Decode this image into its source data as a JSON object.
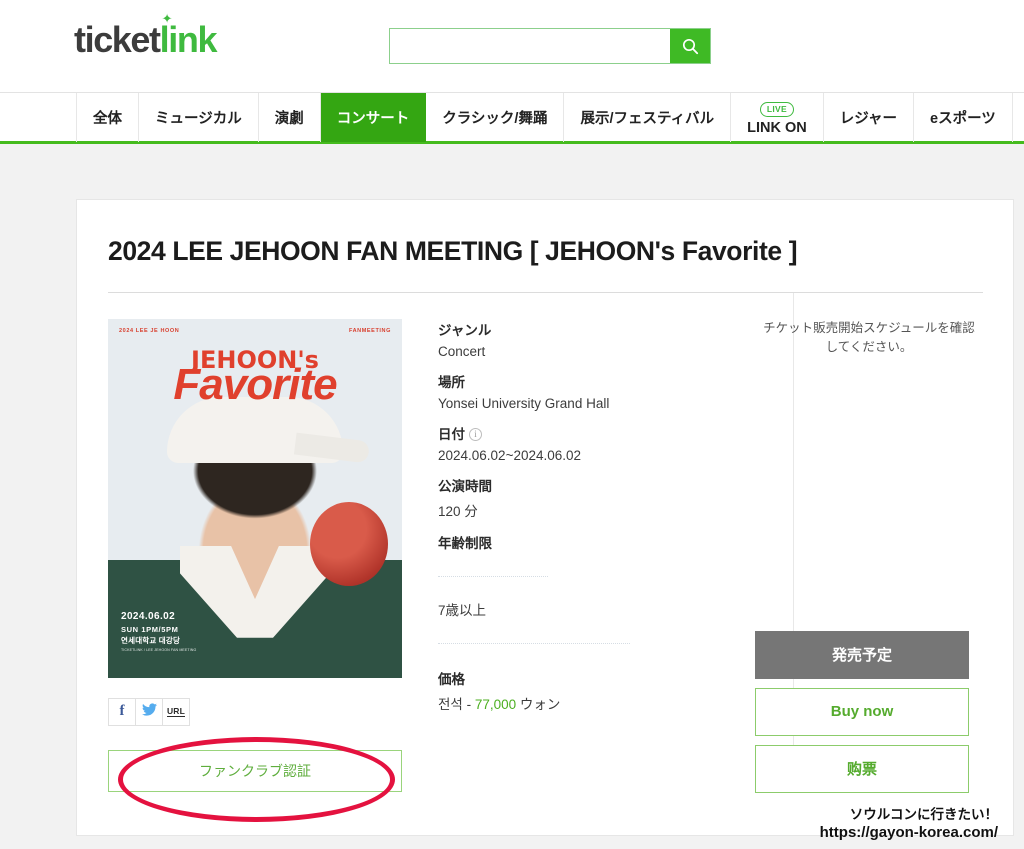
{
  "brand": {
    "logo_part1": "ticket",
    "logo_part2": "link",
    "accent_green": "#3fba3f",
    "nav_active_green": "#34a612",
    "price_green": "#4caf20",
    "annotation_red": "#e4123f"
  },
  "search": {
    "value": "",
    "placeholder": "",
    "icon": "search-icon"
  },
  "nav": {
    "items": [
      {
        "label": "全体",
        "active": false,
        "badge": null
      },
      {
        "label": "ミュージカル",
        "active": false,
        "badge": null
      },
      {
        "label": "演劇",
        "active": false,
        "badge": null
      },
      {
        "label": "コンサート",
        "active": true,
        "badge": null
      },
      {
        "label": "クラシック/舞踊",
        "active": false,
        "badge": null
      },
      {
        "label": "展示/フェスティバル",
        "active": false,
        "badge": null
      },
      {
        "label": "LINK ON",
        "active": false,
        "badge": "LIVE"
      },
      {
        "label": "レジャー",
        "active": false,
        "badge": null
      },
      {
        "label": "eスポーツ",
        "active": false,
        "badge": null
      }
    ]
  },
  "event": {
    "title": "2024 LEE JEHOON FAN MEETING [ JEHOON's Favorite ]",
    "poster": {
      "top_left": "2024 LEE JE HOON",
      "top_right": "FANMEETING",
      "headline1": "JEHOON's",
      "headline2": "Favorite",
      "date": "2024.06.02",
      "time": "SUN 1PM/5PM",
      "venue": "연세대학교 대강당",
      "note": "TICKETLINK / LEE JEHOON FAN MEETING"
    },
    "details": {
      "genre_label": "ジャンル",
      "genre_value": "Concert",
      "place_label": "場所",
      "place_value": "Yonsei University Grand Hall",
      "date_label": "日付",
      "date_info_icon": "info-icon",
      "date_value": "2024.06.02~2024.06.02",
      "runtime_label": "公演時間",
      "runtime_value": "120 分",
      "age_label": "年齢制限",
      "age_value": "7歳以上",
      "price_label": "価格",
      "price_prefix": "전석 - ",
      "price_amount": "77,000",
      "price_suffix": " ウォン"
    },
    "share": {
      "facebook_label": "f",
      "twitter_label": "twitter-icon",
      "url_label": "URL"
    },
    "fanclub_button": "ファンクラブ認証"
  },
  "right_panel": {
    "notice": "チケット販売開始スケジュールを確認してください。",
    "buttons": [
      {
        "label": "発売予定",
        "style": "gray"
      },
      {
        "label": "Buy now",
        "style": "outline"
      },
      {
        "label": "购票",
        "style": "outline"
      }
    ]
  },
  "watermark": {
    "line1": "ソウルコンに行きたい！",
    "line2": "https://gayon-korea.com/"
  }
}
